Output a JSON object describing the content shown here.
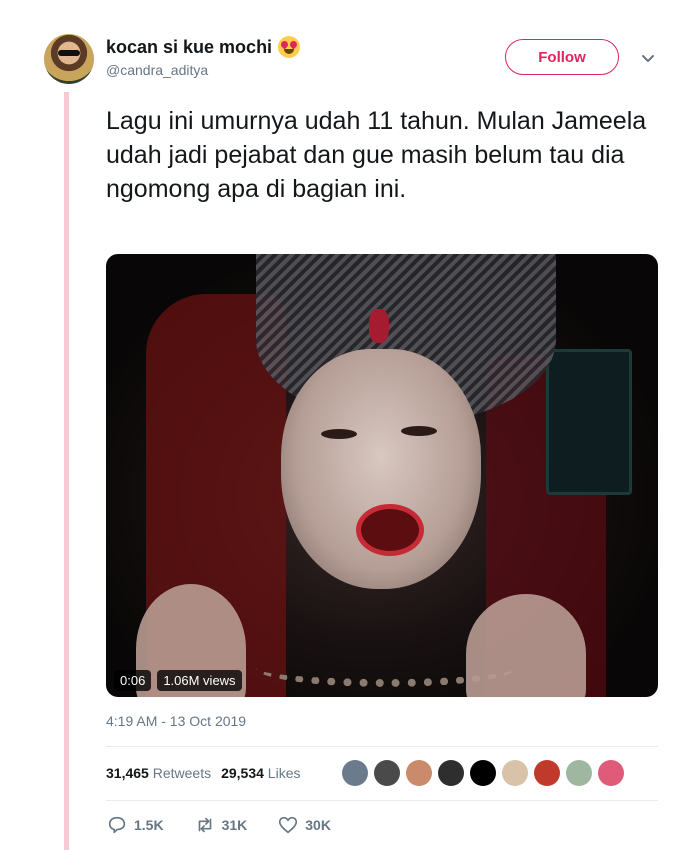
{
  "user": {
    "display_name": "kocan si kue mochi",
    "handle": "@candra_aditya",
    "name_emoji": "heart-eyes-emoji"
  },
  "follow_label": "Follow",
  "tweet_text": "Lagu ini umurnya udah 11 tahun. Mulan Jameela udah jadi pejabat dan gue masih belum tau dia ngomong apa di bagian ini.",
  "media": {
    "duration": "0:06",
    "views": "1.06M views"
  },
  "timestamp": "4:19 AM - 13 Oct 2019",
  "stats": {
    "retweets_count": "31,465",
    "retweets_label": "Retweets",
    "likes_count": "29,534",
    "likes_label": "Likes"
  },
  "likers_colors": [
    "#6b7b8c",
    "#4a4a4a",
    "#c98b6b",
    "#2e2e2e",
    "#000000",
    "#d8c2a8",
    "#c0392b",
    "#9fb7a0",
    "#e05a7a"
  ],
  "actions": {
    "reply_count": "1.5K",
    "retweet_count": "31K",
    "like_count": "30K"
  },
  "colors": {
    "accent": "#e0245e",
    "thread_line": "#f7c9d4",
    "muted_text": "#657786"
  }
}
